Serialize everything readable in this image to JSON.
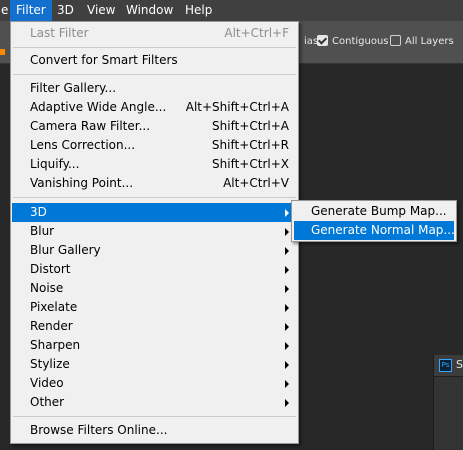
{
  "menubar": {
    "items": [
      "e",
      "Filter",
      "3D",
      "View",
      "Window",
      "Help"
    ]
  },
  "options": {
    "partial_label": "ias",
    "contiguous_label": "Contiguous",
    "contiguous_checked": true,
    "all_layers_label": "All Layers",
    "all_layers_checked": false
  },
  "filter_menu": {
    "items": [
      {
        "label": "Last Filter",
        "shortcut": "Alt+Ctrl+F",
        "disabled": true
      },
      {
        "label": "Convert for Smart Filters",
        "shortcut": ""
      },
      {
        "label": "Filter Gallery...",
        "shortcut": ""
      },
      {
        "label": "Adaptive Wide Angle...",
        "shortcut": "Alt+Shift+Ctrl+A"
      },
      {
        "label": "Camera Raw Filter...",
        "shortcut": "Shift+Ctrl+A"
      },
      {
        "label": "Lens Correction...",
        "shortcut": "Shift+Ctrl+R"
      },
      {
        "label": "Liquify...",
        "shortcut": "Shift+Ctrl+X"
      },
      {
        "label": "Vanishing Point...",
        "shortcut": "Alt+Ctrl+V"
      },
      {
        "label": "3D",
        "submenu": true,
        "highlighted": true
      },
      {
        "label": "Blur",
        "submenu": true
      },
      {
        "label": "Blur Gallery",
        "submenu": true
      },
      {
        "label": "Distort",
        "submenu": true
      },
      {
        "label": "Noise",
        "submenu": true
      },
      {
        "label": "Pixelate",
        "submenu": true
      },
      {
        "label": "Render",
        "submenu": true
      },
      {
        "label": "Sharpen",
        "submenu": true
      },
      {
        "label": "Stylize",
        "submenu": true
      },
      {
        "label": "Video",
        "submenu": true
      },
      {
        "label": "Other",
        "submenu": true
      },
      {
        "label": "Browse Filters Online...",
        "shortcut": ""
      }
    ]
  },
  "submenu_3d": {
    "items": [
      {
        "label": "Generate Bump Map..."
      },
      {
        "label": "Generate Normal Map...",
        "highlighted": true
      }
    ]
  },
  "panel": {
    "icon_text": "Ps",
    "title": "S"
  },
  "colors": {
    "accent": "#0078d7",
    "menubar_active": "#1470cf",
    "menu_bg": "#f0f0f0",
    "app_bg": "#282828"
  },
  "icons": [
    "checkbox-icon",
    "submenu-arrow-icon",
    "ps-icon"
  ]
}
